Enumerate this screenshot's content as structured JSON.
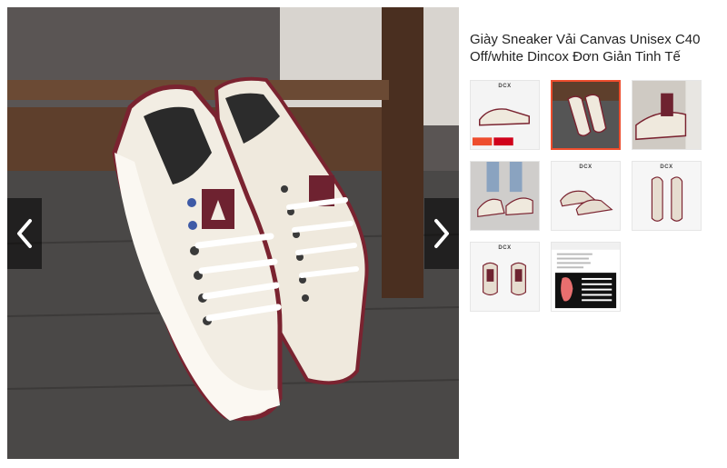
{
  "product": {
    "title": "Giày Sneaker Vải Canvas Unisex C40 Off/white Dincox Đơn Giản Tinh Tế"
  },
  "gallery": {
    "prev_icon": "chevron-left-icon",
    "next_icon": "chevron-right-icon",
    "selected_index": 1,
    "thumbnails": [
      {
        "kind": "side-view",
        "brand": "DCX"
      },
      {
        "kind": "pair-on-floor",
        "brand": ""
      },
      {
        "kind": "closeup-heel",
        "brand": ""
      },
      {
        "kind": "worn-lacing",
        "brand": ""
      },
      {
        "kind": "pair-angled",
        "brand": "DCX"
      },
      {
        "kind": "pair-top",
        "brand": "DCX"
      },
      {
        "kind": "pair-back",
        "brand": "DCX"
      },
      {
        "kind": "size-guide",
        "brand": ""
      }
    ]
  },
  "colors": {
    "accent": "#ee4d2d",
    "shoe": "#efe9dd",
    "trim": "#7a2330"
  }
}
